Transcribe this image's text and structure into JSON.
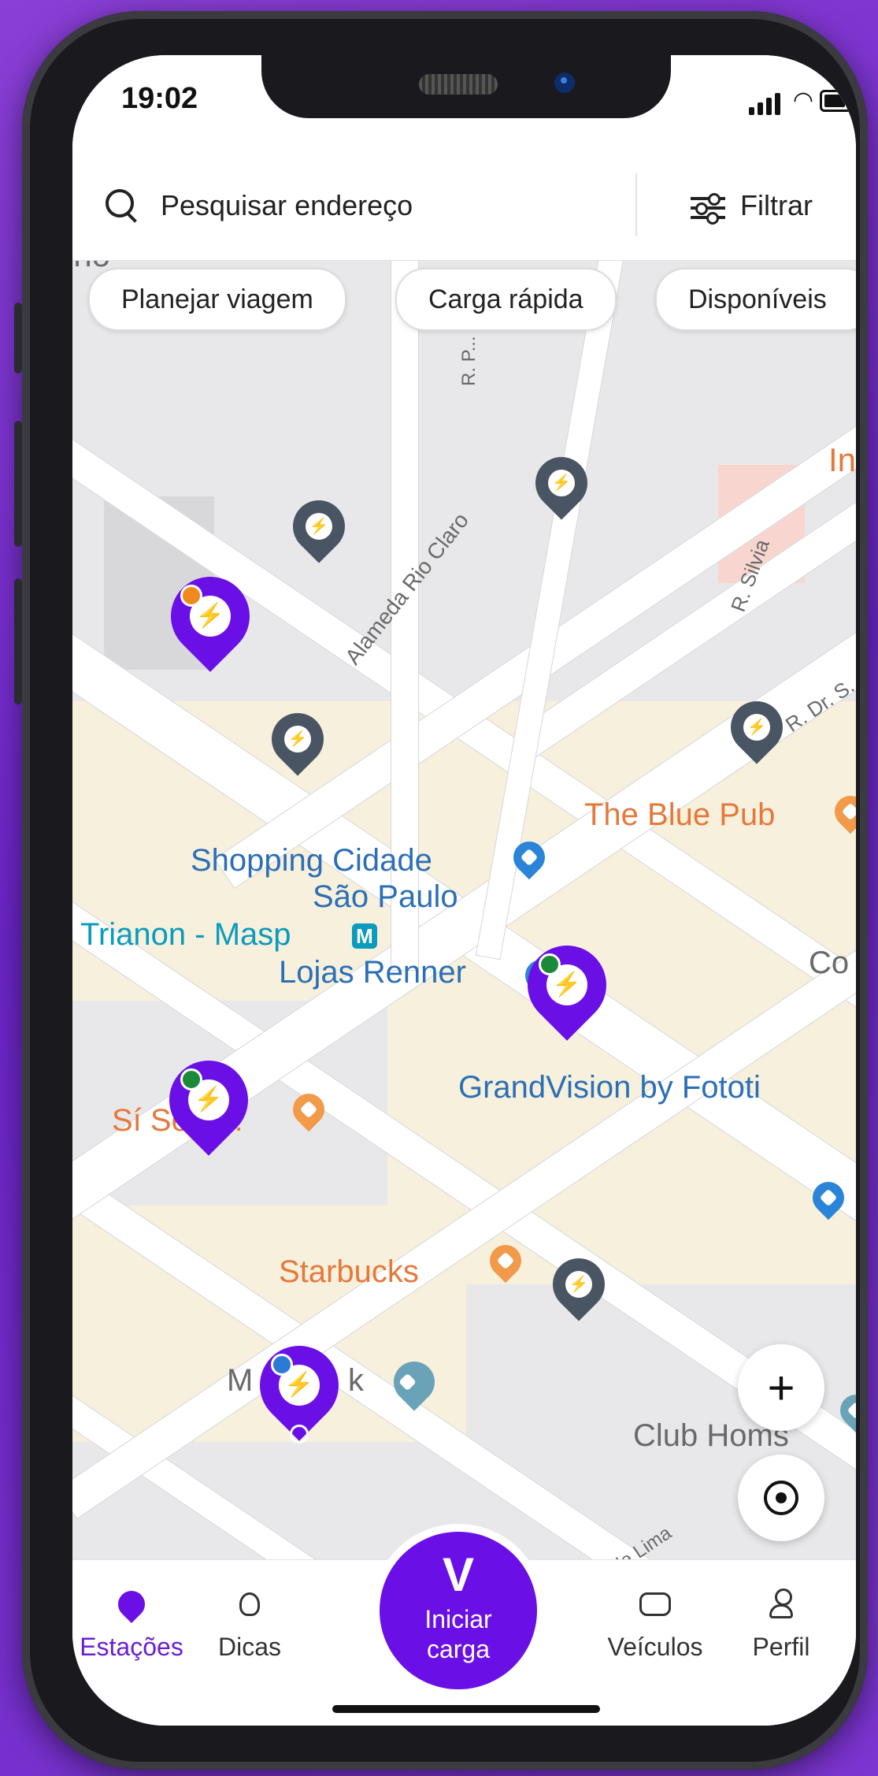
{
  "status": {
    "time": "19:02"
  },
  "search": {
    "placeholder": "Pesquisar endereço",
    "filter_label": "Filtrar"
  },
  "chips": [
    "Planejar viagem",
    "Carga rápida",
    "Disponíveis"
  ],
  "map": {
    "streets": [
      "R. P...",
      "Alameda Rio Claro",
      "R. Silvia",
      "R. Dr. S...",
      "...ônio de Lima"
    ],
    "pois": {
      "shopping_line1": "Shopping Cidade",
      "shopping_line2": "São Paulo",
      "blue_pub": "The Blue Pub",
      "trianon": "Trianon - Masp",
      "lojas_renner": "Lojas Renner",
      "si_senor": "Sí Señor!",
      "grandvision": "GrandVision by Fototi",
      "starbucks": "Starbucks",
      "mk_left": "M",
      "mk_right": "k",
      "club_homs": "Club Homs",
      "co_partial": "Co",
      "in_partial": "In",
      "top_partial": "ino"
    },
    "zoom_in_label": "+"
  },
  "colors": {
    "brand": "#6a10e6",
    "pin_gray": "#4a5563",
    "dot_orange": "#f18a1c",
    "dot_green": "#1a8a3a",
    "dot_blue": "#2a7ad6"
  },
  "tabbar": {
    "stations": "Estações",
    "tips": "Dicas",
    "start_line1": "Iniciar",
    "start_line2": "carga",
    "vehicles": "Veículos",
    "profile": "Perfil"
  }
}
